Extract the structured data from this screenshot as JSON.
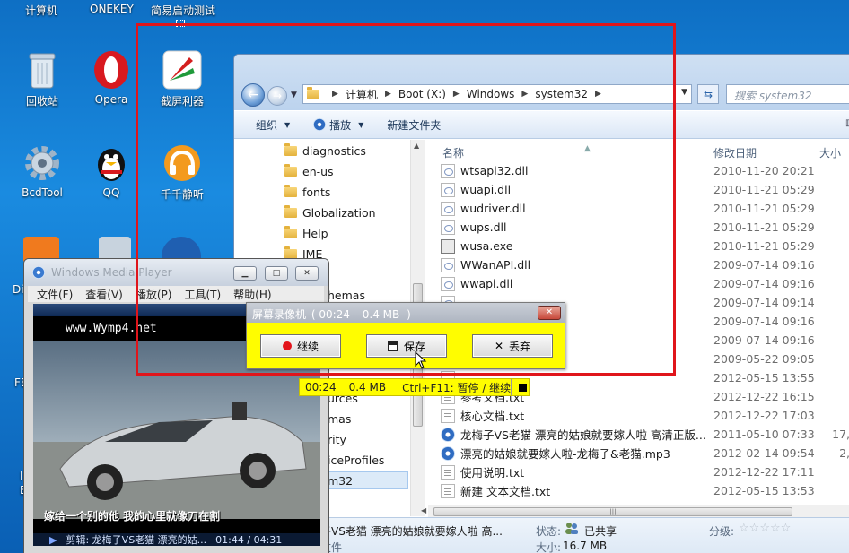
{
  "desktop": {
    "top_labels": [
      "计算机",
      "ONEKEY",
      "简易启动测试"
    ],
    "icons": [
      {
        "label": "回收站",
        "icon": "recycle-bin-icon"
      },
      {
        "label": "Opera",
        "icon": "opera-icon"
      },
      {
        "label": "截屏利器",
        "icon": "screenshot-tool-icon"
      },
      {
        "label": "BcdTool",
        "icon": "gear-icon"
      },
      {
        "label": "QQ",
        "icon": "qq-penguin-icon"
      },
      {
        "label": "千千静听",
        "icon": "headphones-icon"
      }
    ],
    "partial_labels": [
      "Di",
      "FE",
      "I",
      "E"
    ]
  },
  "explorer": {
    "breadcrumb": [
      "计算机",
      "Boot (X:)",
      "Windows",
      "system32"
    ],
    "search_placeholder": "搜索 system32",
    "toolbar": {
      "organize": "组织",
      "play": "播放",
      "new_folder": "新建文件夹"
    },
    "tree": [
      "diagnostics",
      "en-us",
      "fonts",
      "Globalization",
      "Help",
      "IME"
    ],
    "tree_partial": [
      "hemas",
      "urces",
      "mas",
      "rity",
      "iceProfiles",
      "m32"
    ],
    "columns": {
      "name": "名称",
      "date": "修改日期",
      "size": "大小"
    },
    "files": [
      {
        "name": "wtsapi32.dll",
        "date": "2010-11-20 20:21",
        "size": "",
        "type": "dll"
      },
      {
        "name": "wuapi.dll",
        "date": "2010-11-21 05:29",
        "size": "5",
        "type": "dll"
      },
      {
        "name": "wudriver.dll",
        "date": "2010-11-21 05:29",
        "size": "",
        "type": "dll"
      },
      {
        "name": "wups.dll",
        "date": "2010-11-21 05:29",
        "size": "",
        "type": "dll"
      },
      {
        "name": "wusa.exe",
        "date": "2010-11-21 05:29",
        "size": "3",
        "type": "exe"
      },
      {
        "name": "WWanAPI.dll",
        "date": "2009-07-14 09:16",
        "size": "2",
        "type": "dll"
      },
      {
        "name": "wwapi.dll",
        "date": "2009-07-14 09:16",
        "size": "",
        "type": "dll"
      },
      {
        "name": "",
        "date": "2009-07-14 09:14",
        "size": "",
        "type": "dll"
      },
      {
        "name": "",
        "date": "2009-07-14 09:16",
        "size": "",
        "type": "dll"
      },
      {
        "name": "",
        "date": "2009-07-14 09:16",
        "size": "1",
        "type": "dll"
      },
      {
        "name": "",
        "date": "2009-05-22 09:05",
        "size": "",
        "type": "dll"
      },
      {
        "name": "",
        "date": "2012-05-15 13:55",
        "size": "",
        "type": "txt"
      },
      {
        "name": "参考文档.txt",
        "date": "2012-12-22 16:15",
        "size": "",
        "type": "txt"
      },
      {
        "name": "核心文档.txt",
        "date": "2012-12-22 17:03",
        "size": "",
        "type": "txt"
      },
      {
        "name": "龙梅子VS老猫 漂亮的姑娘就要嫁人啦 高清正版...",
        "date": "2011-05-10 07:33",
        "size": "17,1",
        "type": "media"
      },
      {
        "name": "漂亮的姑娘就要嫁人啦-龙梅子&老猫.mp3",
        "date": "2012-02-14 09:54",
        "size": "2,1",
        "type": "media"
      },
      {
        "name": "使用说明.txt",
        "date": "2012-12-22 17:11",
        "size": "",
        "type": "txt"
      },
      {
        "name": "新建 文本文档.txt",
        "date": "2012-05-15 13:53",
        "size": "",
        "type": "txt"
      }
    ],
    "details": {
      "name": "子VS老猫 漂亮的姑娘就要嫁人啦 高...",
      "type": "文件",
      "state_label": "状态:",
      "state_value": "已共享",
      "size_label": "大小:",
      "size_value": "16.7 MB",
      "rating_label": "分级:"
    }
  },
  "player": {
    "title": "Windows Media Player",
    "menu": [
      "文件(F)",
      "查看(V)",
      "播放(P)",
      "工具(T)",
      "帮助(H)"
    ],
    "watermark": "www.Wymp4.net",
    "subtitle": "嫁给一个别的他 我的心里就像刀在割",
    "now_playing": "剪辑: 龙梅子VS老猫 漂亮的姑...",
    "time": "01:44 / 04:31"
  },
  "recorder": {
    "title": "屏幕录像机",
    "title_time": "00:24",
    "title_size": "0.4 MB",
    "continue": "继续",
    "save": "保存",
    "discard": "丢弃",
    "bar_time": "00:24",
    "bar_size": "0.4 MB",
    "hotkey": "Ctrl+F11: 暂停 / 继续"
  },
  "colors": {
    "highlight_rect": "#e0151b",
    "recorder_bg": "#fffd00",
    "desktop_bg": "#1a8be0"
  }
}
